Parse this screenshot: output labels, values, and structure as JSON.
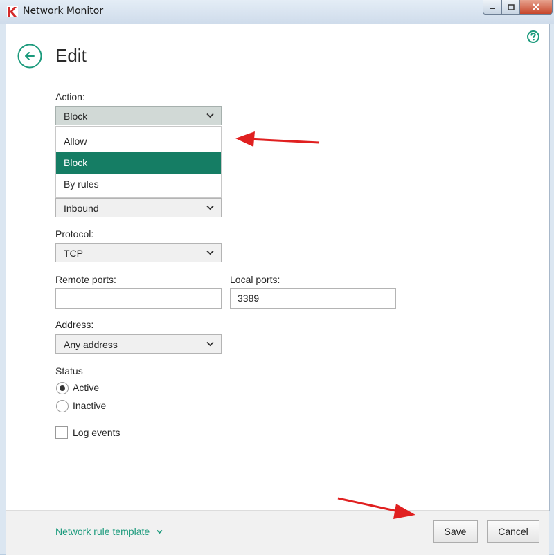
{
  "window": {
    "title": "Network Monitor"
  },
  "page": {
    "title": "Edit"
  },
  "action": {
    "label": "Action:",
    "value": "Block",
    "options": [
      "Allow",
      "Block",
      "By rules"
    ],
    "selected_index": 1
  },
  "direction": {
    "value": "Inbound"
  },
  "protocol": {
    "label": "Protocol:",
    "value": "TCP"
  },
  "remote_ports": {
    "label": "Remote ports:",
    "value": ""
  },
  "local_ports": {
    "label": "Local ports:",
    "value": "3389"
  },
  "address": {
    "label": "Address:",
    "value": "Any address"
  },
  "status": {
    "label": "Status",
    "options": [
      "Active",
      "Inactive"
    ],
    "selected": "Active"
  },
  "log_events": {
    "label": "Log events",
    "checked": false
  },
  "footer": {
    "template_link": "Network rule template",
    "save_label": "Save",
    "cancel_label": "Cancel"
  },
  "colors": {
    "accent": "#157d64",
    "link": "#1b9a7c",
    "annotation_arrow": "#e02020"
  },
  "icons": [
    "app-icon",
    "minimize-icon",
    "maximize-icon",
    "close-icon",
    "help-icon",
    "back-arrow-icon",
    "chevron-down-icon"
  ]
}
